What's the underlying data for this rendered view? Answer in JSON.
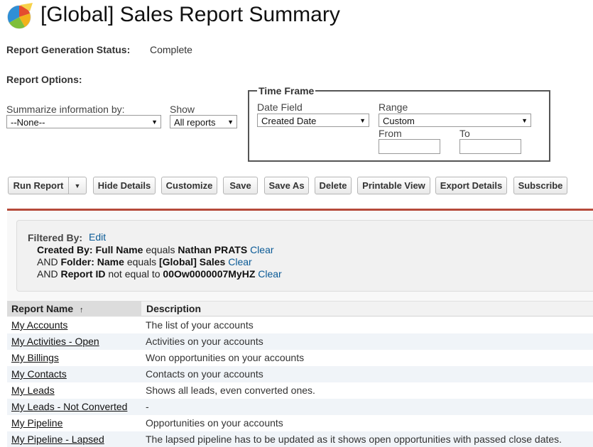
{
  "header": {
    "title": "[Global] Sales Report Summary"
  },
  "status": {
    "label": "Report Generation Status:",
    "value": "Complete"
  },
  "options": {
    "label": "Report Options:",
    "summarize_label": "Summarize information by:",
    "summarize_value": "--None--",
    "show_label": "Show",
    "show_value": "All reports"
  },
  "time_frame": {
    "legend": "Time Frame",
    "date_field_label": "Date Field",
    "date_field_value": "Created Date",
    "range_label": "Range",
    "range_value": "Custom",
    "from_label": "From",
    "to_label": "To"
  },
  "toolbar": {
    "run_report": "Run Report",
    "hide_details": "Hide Details",
    "customize": "Customize",
    "save": "Save",
    "save_as": "Save As",
    "delete": "Delete",
    "printable_view": "Printable View",
    "export_details": "Export Details",
    "subscribe": "Subscribe"
  },
  "filters": {
    "title": "Filtered By:",
    "edit": "Edit",
    "clear": "Clear",
    "lines": [
      {
        "prefix": "",
        "field": "Created By: Full Name",
        "op": "equals",
        "value": "Nathan PRATS"
      },
      {
        "prefix": "AND",
        "field": "Folder: Name",
        "op": "equals",
        "value": "[Global] Sales"
      },
      {
        "prefix": "AND",
        "field": "Report ID",
        "op": "not equal to",
        "value": "00Ow0000007MyHZ"
      }
    ]
  },
  "table": {
    "col_name": "Report Name",
    "sort_indicator": "↑",
    "col_desc": "Description",
    "rows": [
      {
        "name": "My Accounts",
        "desc": "The list of your accounts"
      },
      {
        "name": "My Activities - Open",
        "desc": "Activities on your accounts"
      },
      {
        "name": "My Billings",
        "desc": "Won opportunities on your accounts"
      },
      {
        "name": "My Contacts",
        "desc": "Contacts on your accounts"
      },
      {
        "name": "My Leads",
        "desc": "Shows all leads, even converted ones."
      },
      {
        "name": "My Leads - Not Converted",
        "desc": "-"
      },
      {
        "name": "My Pipeline",
        "desc": "Opportunities on your accounts"
      },
      {
        "name": "My Pipeline - Lapsed",
        "desc": "The lapsed pipeline has to be updated as it shows open opportunities with passed close dates."
      }
    ]
  }
}
